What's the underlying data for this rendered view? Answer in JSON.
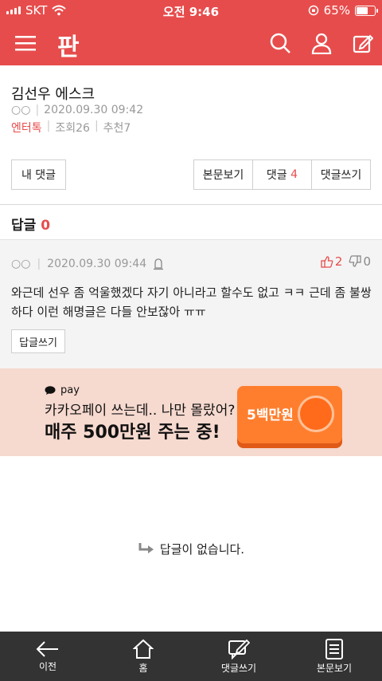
{
  "status_bar": {
    "carrier": "SKT",
    "time": "오전 9:46",
    "battery": "65%",
    "battery_level": 0.65
  },
  "header": {
    "logo": "판",
    "icons": [
      "menu-icon",
      "search-icon",
      "user-icon",
      "edit-icon"
    ]
  },
  "article": {
    "title": "김선우 에스크",
    "author": "○○",
    "date": "2020.09.30 09:42",
    "category": "엔터톡",
    "views_label": "조회26",
    "recommend_label": "추천7"
  },
  "buttons": {
    "my_comments": "내 댓글",
    "view_post": "본문보기",
    "comments_label": "댓글",
    "comments_count": "4",
    "write_comment": "댓글쓰기"
  },
  "reply_section": {
    "label": "답글",
    "count": "0"
  },
  "comment": {
    "author": "○○",
    "date": "2020.09.30 09:44",
    "likes": "2",
    "dislikes": "0",
    "body": "와근데 선우 좀 억울했겠다 자기 아니라고 할수도 없고 ㅋㅋ 근데 좀 불쌍하다 이런 해명글은 다들 안보잖아 ㅠㅠ",
    "reply_button": "답글쓰기"
  },
  "ad": {
    "brand": "pay",
    "line1": "카카오페이 쓰는데.. 나만 몰랐어?",
    "line2": "매주 500만원 주는 중!",
    "badge": "5백만원"
  },
  "empty_message": "답글이 없습니다.",
  "bottom_nav": {
    "back": "이전",
    "home": "홈",
    "write": "댓글쓰기",
    "view": "본문보기"
  },
  "colors": {
    "accent": "#e74c4c",
    "bottom_bar": "#333333"
  }
}
